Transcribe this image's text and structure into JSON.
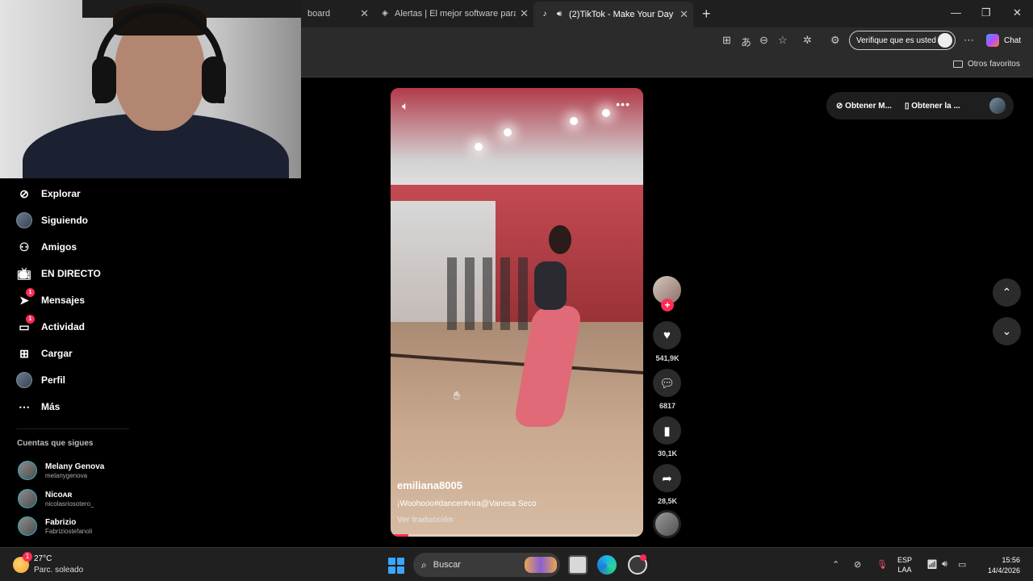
{
  "browser": {
    "tabs": [
      {
        "title": "board",
        "active": false
      },
      {
        "title": "Alertas | El mejor software para pu",
        "active": false
      },
      {
        "title": "(2)TikTok - Make Your Day",
        "active": true
      }
    ],
    "verify_label": "Verifique que es usted",
    "chat_label": "Chat",
    "favorites_other": "Otros favoritos"
  },
  "sidebar": {
    "items": [
      {
        "label": "Explorar",
        "icon": "compass-icon",
        "badge": ""
      },
      {
        "label": "Siguiendo",
        "icon": "avatar",
        "badge": ""
      },
      {
        "label": "Amigos",
        "icon": "friends-icon",
        "badge": ""
      },
      {
        "label": "EN DIRECTO",
        "icon": "live-icon",
        "badge": ""
      },
      {
        "label": "Mensajes",
        "icon": "message-icon",
        "badge": "1"
      },
      {
        "label": "Actividad",
        "icon": "activity-icon",
        "badge": "1"
      },
      {
        "label": "Cargar",
        "icon": "upload-icon",
        "badge": ""
      },
      {
        "label": "Perfil",
        "icon": "avatar",
        "badge": ""
      },
      {
        "label": "Más",
        "icon": "more-icon",
        "badge": ""
      }
    ],
    "following_title": "Cuentas que sigues",
    "following": [
      {
        "name": "Melany Genova",
        "username": "melanygenova"
      },
      {
        "name": "Nicoᴀʀ",
        "username": "nicolasriosotero_"
      },
      {
        "name": "Fabrizio",
        "username": "Fabriziostefanoli"
      }
    ]
  },
  "video": {
    "author": "emiliana8005",
    "caption": "¡Woohooo#dancer#vira@Vanesa Seco",
    "translate": "Ver traducción",
    "progress": 0.07
  },
  "actions": {
    "likes": "541,9K",
    "comments": "6817",
    "saves": "30,1K",
    "shares": "28,5K"
  },
  "top_right": {
    "pill1": "Obtener M...",
    "pill2": "Obtener la ..."
  },
  "taskbar": {
    "temp": "27°C",
    "condition": "Parc. soleado",
    "weather_badge": "1",
    "search_label": "Buscar",
    "lang_top": "ESP",
    "lang_bottom": "LAA",
    "time": "15:56",
    "date": "14/4/2026"
  },
  "colors": {
    "accent": "#fe2c55",
    "background": "#000000",
    "browser_chrome": "#2b2b2b"
  }
}
